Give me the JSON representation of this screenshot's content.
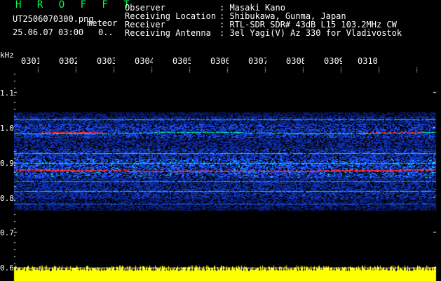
{
  "header": {
    "station": "H R O F F T",
    "filename": "UT2506070300.png",
    "filename_tag": "meteor",
    "datetime": "25.06.07 03:00",
    "count": "0.."
  },
  "meta": [
    {
      "label": "Observer",
      "value": ": Masaki Kano"
    },
    {
      "label": "Receiving Location",
      "value": ": Shibukawa, Gunma, Japan"
    },
    {
      "label": "Receiver",
      "value": ": RTL-SDR SDR# 43dB L15 103.2MHz CW"
    },
    {
      "label": "Receiving Antenna",
      "value": ": 3el Yagi(V) Az 330 for Vladivostok"
    }
  ],
  "axes": {
    "y_unit": "kHz",
    "y_ticks": [
      "1.1",
      "1.0",
      "0.9",
      "0.8",
      "0.7",
      "0.6"
    ],
    "x_ticks": [
      "0301",
      "0302",
      "0303",
      "0304",
      "0305",
      "0306",
      "0307",
      "0308",
      "0309",
      "0310"
    ]
  },
  "colors": {
    "background": "#000000",
    "low": "#0a1a6e",
    "mid": "#1d4fff",
    "high": "#00d8ff",
    "peak": "#ff2a2a",
    "signal": "#ffff00",
    "title_green": "#00ff4c"
  }
}
